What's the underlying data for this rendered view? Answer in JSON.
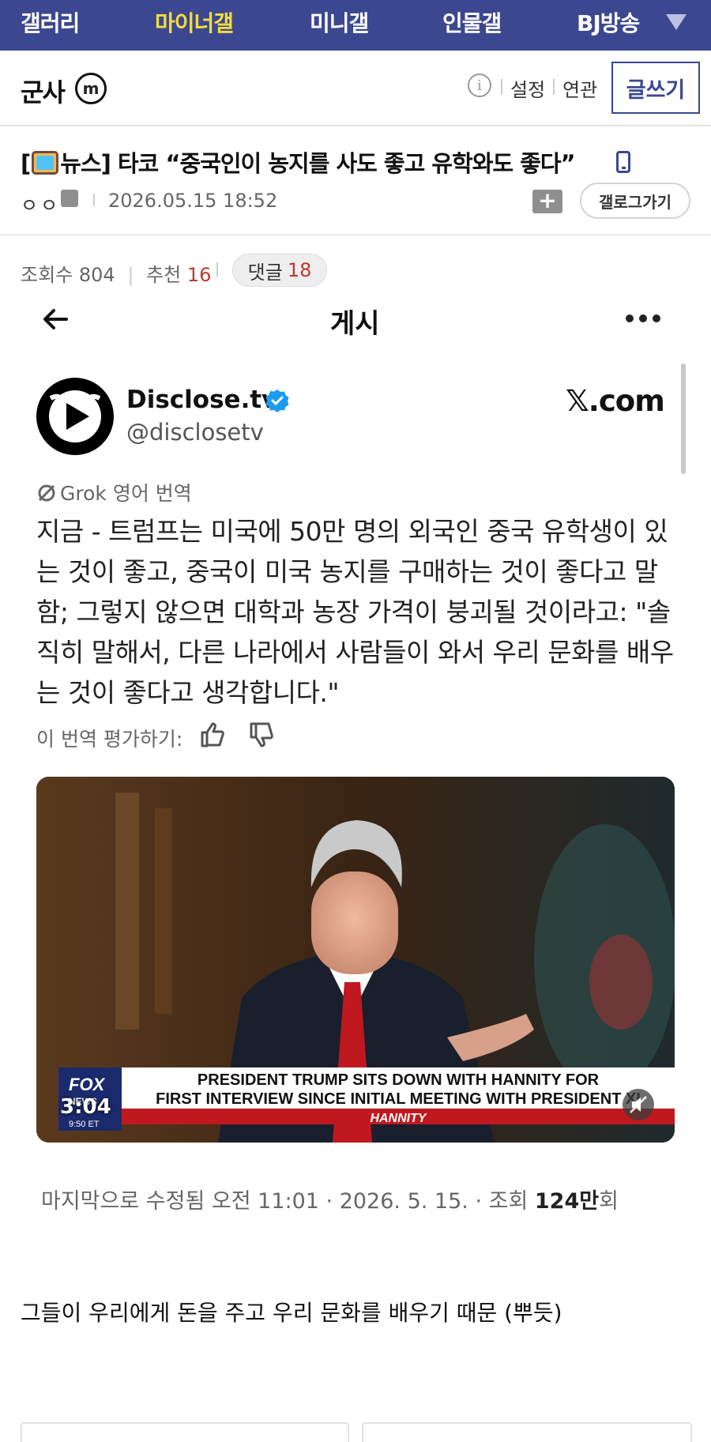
{
  "topnav": {
    "items": [
      {
        "label": "갤러리",
        "active": false
      },
      {
        "label": "마이너갤",
        "active": true
      },
      {
        "label": "미니갤",
        "active": false
      },
      {
        "label": "인물갤",
        "active": false
      },
      {
        "label": "BJ방송",
        "active": false
      }
    ],
    "more_icon": "triangle-down-icon"
  },
  "gallery_header": {
    "name": "군사",
    "badge": "m",
    "info_icon": "info-icon",
    "links": [
      "설정",
      "연관"
    ],
    "write_label": "글쓰기"
  },
  "post": {
    "title_prefix_open": "[",
    "title_category": "뉴스]",
    "title_text": "타코 “중국인이 농지를 사도 좋고 유학와도 좋다”",
    "category_icon": "tv-icon",
    "mobile_icon": "mobile-phone-icon",
    "author": "ㅇㅇ",
    "author_icon": "fixed-nick-icon",
    "date": "2026.05.15 18:52",
    "folder_icon": "add-folder-icon",
    "gallery_back_label": "갤로그가기",
    "stats": {
      "views_label": "조회수",
      "views": "804",
      "likes_label": "추천",
      "likes": "16",
      "comments_label": "댓글",
      "comments": "18"
    },
    "body_text": "그들이 우리에게 돈을 주고 우리 문화를 배우기 때문 (뿌듯)"
  },
  "embed": {
    "header_title": "게시",
    "author_name": "Disclose.tv",
    "handle": "@disclosetv",
    "site": "𝕏.com",
    "grok_label": "Grok 영어 번역",
    "tweet_text": "지금 - 트럼프는 미국에 50만 명의 외국인 중국 유학생이 있는 것이 좋고, 중국이 미국 농지를 구매하는 것이 좋다고 말함; 그렇지 않으면 대학과 농장 가격이 붕괴될 것이라고: \"솔직히 말해서, 다른 나라에서 사람들이 와서 우리 문화를 배우는 것이 좋다고 생각합니다.\"",
    "rate_label": "이 번역 평가하기:",
    "video": {
      "chyron_line1": "PRESIDENT TRUMP SITS DOWN WITH HANNITY FOR",
      "chyron_line2": "FIRST INTERVIEW SINCE INITIAL MEETING WITH PRESIDENT XI",
      "show": "HANNITY",
      "network": "FOX",
      "network_sub": "NEWS",
      "time": "9:50 ET",
      "duration": "3:04"
    },
    "modified_text": "마지막으로 수정됨 오전 11:01 · 2026. 5. 15.  · 조회 ",
    "view_count": "124만",
    "view_suffix": "회"
  },
  "colors": {
    "nav_bg": "#3b4890",
    "nav_active": "#f5dc3c",
    "accent_red": "#c0392b",
    "verified_blue": "#1d9bf0"
  }
}
